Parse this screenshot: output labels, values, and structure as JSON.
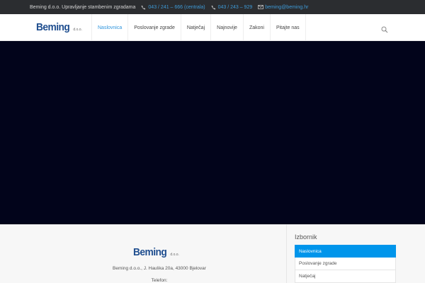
{
  "topbar": {
    "tagline": "Beming d.o.o. Upravljanje stambenim zgradama",
    "contacts": [
      {
        "icon": "phone-icon",
        "text": "043 / 241 – 666 (centrala)"
      },
      {
        "icon": "phone-icon",
        "text": "043 / 243 – 929"
      },
      {
        "icon": "mail-icon",
        "text": "beming@beming.hr"
      }
    ]
  },
  "header": {
    "logo_word": "Beming",
    "logo_suffix": "d.o.o.",
    "nav": [
      "Naslovnica",
      "Poslovanje zgrade",
      "Natječaj",
      "Najnovije",
      "Zakoni",
      "Pitajte nas"
    ],
    "active_index": 0
  },
  "footer": {
    "logo_word": "Beming",
    "logo_suffix": "d.o.o.",
    "address": "Beming d.o.o., J. Haulika 20a, 43000 Bjelovar",
    "phone_label": "Telefon:"
  },
  "sidebar": {
    "title": "Izbornik",
    "items": [
      "Naslovnica",
      "Poslovanje zgrade",
      "Natječaj"
    ],
    "active_index": 0
  },
  "colors": {
    "accent": "#2f95dd",
    "active_menu": "#0095eb",
    "topbar_bg": "#2b2d30",
    "hero_bg": "#02041b",
    "logo": "#1f4e8f"
  }
}
